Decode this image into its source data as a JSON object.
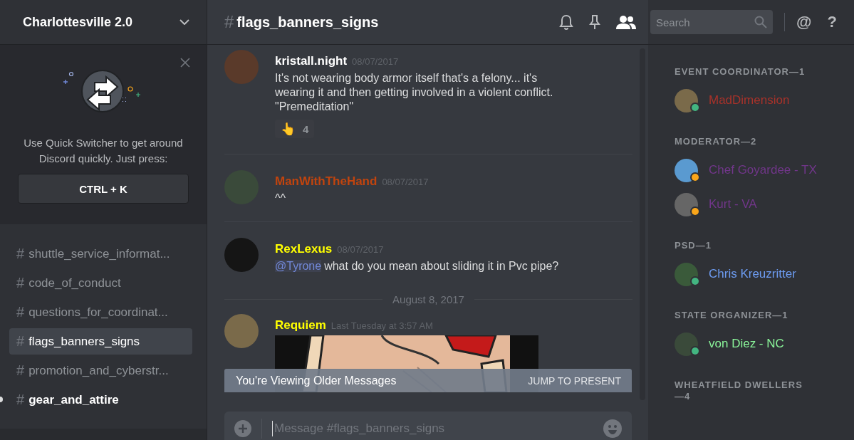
{
  "server": {
    "name": "Charlottesville 2.0"
  },
  "quick_switcher": {
    "text": "Use Quick Switcher to get around Discord quickly. Just press:",
    "shortcut": "CTRL + K"
  },
  "channels": [
    {
      "hash": "#",
      "name": "shuttle_service_informat...",
      "selected": false,
      "unread": false
    },
    {
      "hash": "#",
      "name": "code_of_conduct",
      "selected": false,
      "unread": false
    },
    {
      "hash": "#",
      "name": "questions_for_coordinat...",
      "selected": false,
      "unread": false
    },
    {
      "hash": "#",
      "name": "flags_banners_signs",
      "selected": true,
      "unread": false
    },
    {
      "hash": "#",
      "name": "promotion_and_cyberstr...",
      "selected": false,
      "unread": false
    },
    {
      "hash": "#",
      "name": "gear_and_attire",
      "selected": false,
      "unread": true
    }
  ],
  "header": {
    "hash": "#",
    "channel": "flags_banners_signs",
    "search_placeholder": "Search",
    "mention": "@",
    "help": "?"
  },
  "messages": [
    {
      "kind": "message",
      "author": "kristall.night",
      "color": "#ffffff",
      "time": "08/07/2017",
      "lines": [
        "It's not wearing body armor itself that's a felony... it's",
        "wearing it and then getting involved in a violent conflict.",
        "\"Premeditation\""
      ],
      "reaction": {
        "emoji": "👆",
        "count": "4"
      }
    },
    {
      "kind": "message",
      "author": "ManWithTheHand",
      "color": "#c1440e",
      "time": "08/07/2017",
      "lines": [
        "^^"
      ]
    },
    {
      "kind": "message",
      "author": "RexLexus",
      "color": "#ffff00",
      "time": "08/07/2017",
      "mention": "@Tyrone",
      "lines": [
        "what do you mean about sliding it in Pvc pipe?"
      ]
    },
    {
      "kind": "date",
      "label": "August 8, 2017"
    },
    {
      "author": "Requiem",
      "color": "#ffff00",
      "time": "Last Tuesday at 3:57 AM"
    }
  ],
  "older_bar": {
    "text": "You're Viewing Older Messages",
    "action": "JUMP TO PRESENT"
  },
  "composer": {
    "placeholder": "Message #flags_banners_signs"
  },
  "member_groups": [
    {
      "title": "EVENT COORDINATOR—1",
      "members": [
        {
          "name": "MadDimension",
          "color": "#a8322a",
          "status": {
            "color": "#43b581"
          }
        }
      ]
    },
    {
      "title": "MODERATOR—2",
      "members": [
        {
          "name": "Chef Goyardee - TX",
          "color": "#71368a",
          "status": {
            "color": "#faa61a"
          }
        },
        {
          "name": "Kurt - VA",
          "color": "#71368a",
          "status": {
            "color": "#faa61a"
          }
        }
      ]
    },
    {
      "title": "PSD—1",
      "members": [
        {
          "name": "Chris Kreuzritter",
          "color": "#6d9cf2",
          "status": {
            "color": "#43b581"
          }
        }
      ]
    },
    {
      "title": "STATE ORGANIZER—1",
      "members": [
        {
          "name": "von Diez - NC",
          "color": "#8af59a",
          "status": {
            "color": "#43b581"
          }
        }
      ]
    },
    {
      "title": "WHEATFIELD DWELLERS—4"
    }
  ]
}
